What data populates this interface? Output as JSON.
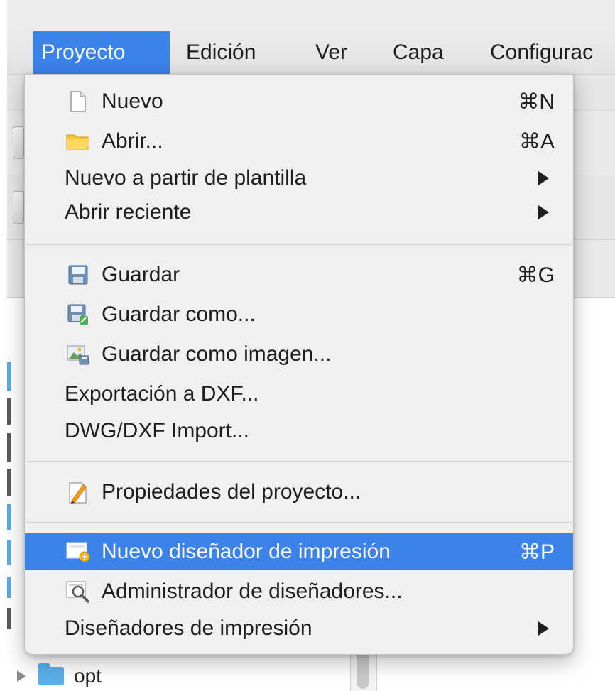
{
  "menubar": {
    "items": [
      {
        "label": "Proyecto",
        "active": true
      },
      {
        "label": "Edición",
        "active": false
      },
      {
        "label": "Ver",
        "active": false
      },
      {
        "label": "Capa",
        "active": false
      },
      {
        "label": "Configurac",
        "active": false
      }
    ]
  },
  "menu": {
    "items": [
      {
        "label": "Nuevo",
        "shortcut": "⌘N",
        "icon": "new-file-icon"
      },
      {
        "label": "Abrir...",
        "shortcut": "⌘A",
        "icon": "folder-open-icon"
      },
      {
        "label": "Nuevo a partir de plantilla",
        "submenu": true
      },
      {
        "label": "Abrir reciente",
        "submenu": true
      },
      {
        "label": "Guardar",
        "shortcut": "⌘G",
        "icon": "save-icon"
      },
      {
        "label": "Guardar como...",
        "icon": "save-as-icon"
      },
      {
        "label": "Guardar como imagen...",
        "icon": "save-as-image-icon"
      },
      {
        "label": "Exportación a DXF..."
      },
      {
        "label": "DWG/DXF Import..."
      },
      {
        "label": "Propiedades del proyecto...",
        "icon": "project-properties-icon"
      },
      {
        "label": "Nuevo diseñador de impresión",
        "shortcut": "⌘P",
        "icon": "new-print-layout-icon",
        "highlighted": true
      },
      {
        "label": "Administrador de diseñadores...",
        "icon": "layout-manager-icon"
      },
      {
        "label": "Diseñadores de impresión",
        "submenu": true
      }
    ]
  },
  "background": {
    "tree_item": {
      "label": "opt",
      "icon": "folder-icon"
    }
  },
  "colors": {
    "highlight": "#3b82ea",
    "menu_bg": "#f0f0f0",
    "text": "#1e1e1e"
  }
}
